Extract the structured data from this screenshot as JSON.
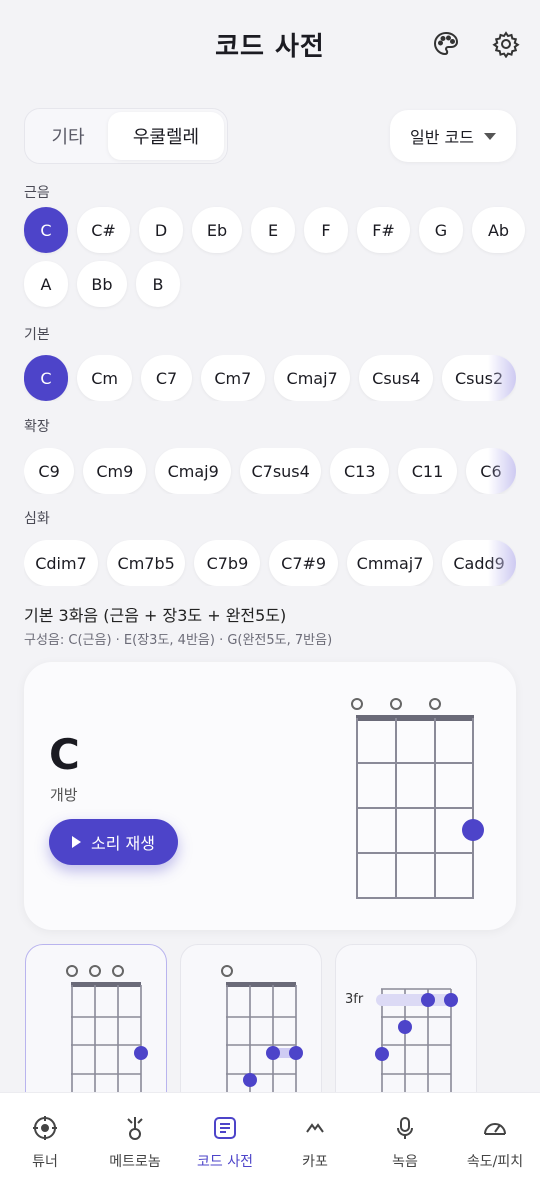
{
  "header": {
    "title": "코드 사전",
    "palette_icon": "palette-icon",
    "settings_icon": "gear-icon"
  },
  "instrument_tabs": [
    {
      "label": "기타",
      "active": false
    },
    {
      "label": "우쿨렐레",
      "active": true
    }
  ],
  "chord_type_dropdown": {
    "value": "일반 코드"
  },
  "root_section": {
    "label": "근음",
    "notes": [
      "C",
      "C#",
      "D",
      "Eb",
      "E",
      "F",
      "F#",
      "G",
      "Ab",
      "A",
      "Bb",
      "B"
    ],
    "selected": "C"
  },
  "basic_section": {
    "label": "기본",
    "chords": [
      "C",
      "Cm",
      "C7",
      "Cm7",
      "Cmaj7",
      "Csus4",
      "Csus2"
    ],
    "selected": "C"
  },
  "extended_section": {
    "label": "확장",
    "chords": [
      "C9",
      "Cm9",
      "Cmaj9",
      "C7sus4",
      "C13",
      "C11",
      "C6"
    ]
  },
  "advanced_section": {
    "label": "심화",
    "chords": [
      "Cdim7",
      "Cm7b5",
      "C7b9",
      "C7#9",
      "Cmmaj7",
      "Cadd9"
    ]
  },
  "chord_info": {
    "description": "기본 3화음 (근음 + 장3도 + 완전5도)",
    "composition": "구성음: C(근음) · E(장3도, 4반음) · G(완전5도, 7반음)"
  },
  "chord_card": {
    "name": "C",
    "voicing": "개방",
    "play_label": "소리 재생"
  },
  "voicings": [
    {
      "fret_label": ""
    },
    {
      "fret_label": ""
    },
    {
      "fret_label": "3fr"
    }
  ],
  "bottom_nav": [
    {
      "label": "튜너",
      "icon": "tuner-icon"
    },
    {
      "label": "메트로놈",
      "icon": "metronome-icon"
    },
    {
      "label": "코드 사전",
      "icon": "chord-dictionary-icon",
      "active": true
    },
    {
      "label": "카포",
      "icon": "capo-icon"
    },
    {
      "label": "녹음",
      "icon": "microphone-icon"
    },
    {
      "label": "속도/피치",
      "icon": "speed-gauge-icon"
    }
  ],
  "colors": {
    "accent": "#4d44c9",
    "background": "#f3f3f6"
  }
}
